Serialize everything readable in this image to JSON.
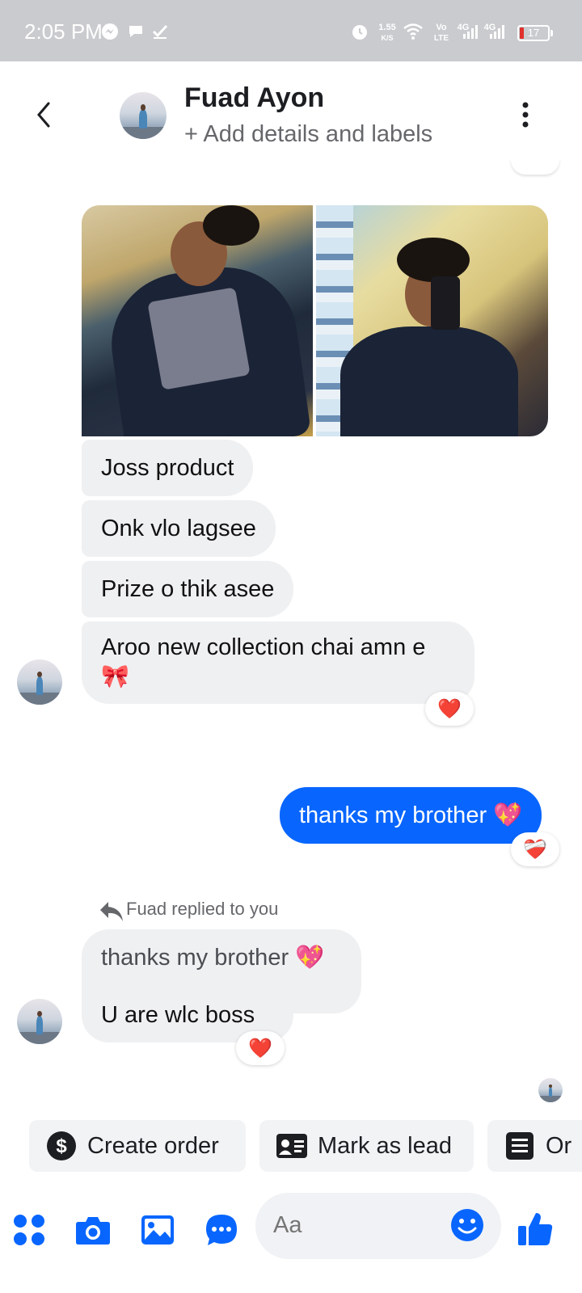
{
  "status_bar": {
    "time": "2:05 PM",
    "net_speed_value": "1.55",
    "net_speed_unit": "K/S",
    "volte_top": "Vo",
    "volte_bottom": "LTE",
    "net1": "4G",
    "net2": "4G",
    "battery": "17",
    "icons": [
      "messenger-icon",
      "chat-bubble-icon",
      "check-icon",
      "alarm-icon",
      "wifi-icon",
      "signal-icon",
      "signal-icon",
      "battery-icon"
    ]
  },
  "header": {
    "name": "Fuad Ayon",
    "subtitle": "+ Add details and labels",
    "icons": [
      "back-arrow-icon",
      "more-options-icon"
    ]
  },
  "messages": {
    "m1": "Joss product",
    "m2": "Onk vlo lagsee",
    "m3": "Prize o thik asee",
    "m4_line1": "Aroo new collection chai amn e",
    "m4_emoji": "🎀",
    "m4_reaction": "❤️",
    "sent": "thanks my brother 💖",
    "sent_reaction": "❤️‍🩹",
    "reply_label": "Fuad replied to you",
    "reply_quote": "thanks my brother 💖",
    "reply_text": "U are wlc boss",
    "reply_reaction": "❤️"
  },
  "actions": {
    "create_order": "Create order",
    "mark_as_lead": "Mark as lead",
    "third": "Or"
  },
  "composer": {
    "placeholder": "Aa"
  },
  "colors": {
    "accent": "#0866ff",
    "bubble_received": "#eff0f2",
    "status_bar": "#c9cbce"
  }
}
